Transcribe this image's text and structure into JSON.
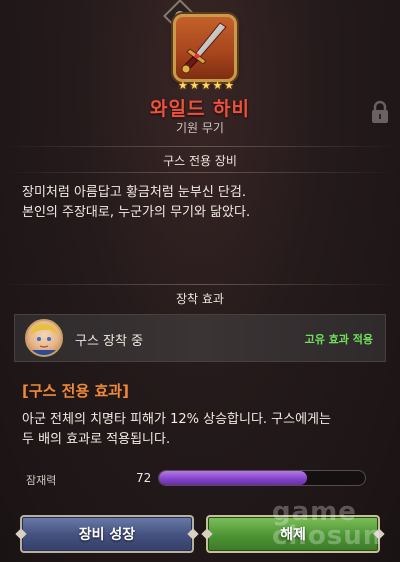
{
  "item": {
    "name": "와일드 하비",
    "type": "기원 무기",
    "stars": 5,
    "icon": "sword-icon",
    "locked": true
  },
  "exclusive": {
    "title": "구스 전용 장비",
    "description_line1": "장미처럼 아름답고 황금처럼 눈부신 단검.",
    "description_line2": "본인의 주장대로, 누군가의 무기와 닮았다."
  },
  "equip": {
    "title": "장착 효과",
    "status": "구스 장착 중",
    "unique_effect": "고유 효과 적용"
  },
  "effect": {
    "title": "[구스 전용 효과]",
    "description_line1": "아군 전체의 치명타 피해가 12% 상승합니다. 구스에게는",
    "description_line2": "두 배의 효과로 적용됩니다."
  },
  "potential": {
    "label": "잠재력",
    "value": "72",
    "fill_fraction": 0.72
  },
  "buttons": {
    "grow": "장비 성장",
    "release": "해제"
  },
  "watermark": {
    "line1": "game",
    "line2": "chosun"
  },
  "colors": {
    "name": "#f0513a",
    "unique": "#6ee05a",
    "effect_title": "#f08a3a",
    "bar": "#8240c8"
  }
}
